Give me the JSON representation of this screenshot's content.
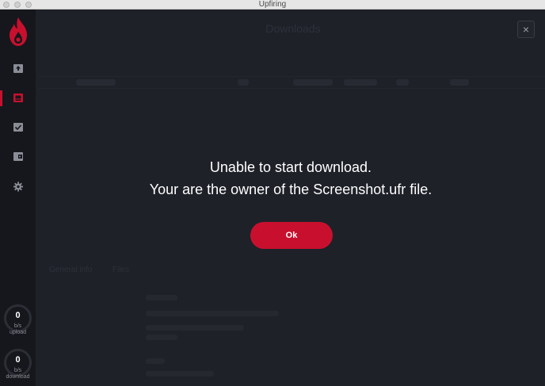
{
  "window": {
    "title": "Upfiring"
  },
  "sidebar": {
    "items": [
      {
        "name": "upload",
        "icon": "upload-box-icon",
        "active": false
      },
      {
        "name": "downloads",
        "icon": "download-box-icon",
        "active": true
      },
      {
        "name": "completed",
        "icon": "checkbox-icon",
        "active": false
      },
      {
        "name": "wallet",
        "icon": "wallet-icon",
        "active": false
      },
      {
        "name": "settings",
        "icon": "gear-icon",
        "active": false
      }
    ],
    "upload_meter": {
      "value": "0",
      "unit": "b/s",
      "label": "upload"
    },
    "download_meter": {
      "value": "0",
      "unit": "b/s",
      "label": "download"
    }
  },
  "background": {
    "page_title": "Downloads",
    "tabs": [
      "General info",
      "Files"
    ]
  },
  "dialog": {
    "line1": "Unable to start download.",
    "line2": "Your are the owner of the Screenshot.ufr file.",
    "ok_label": "Ok",
    "close_symbol": "×"
  },
  "colors": {
    "accent": "#c8102e",
    "background": "#1f2129",
    "sidebar": "#16171c"
  }
}
